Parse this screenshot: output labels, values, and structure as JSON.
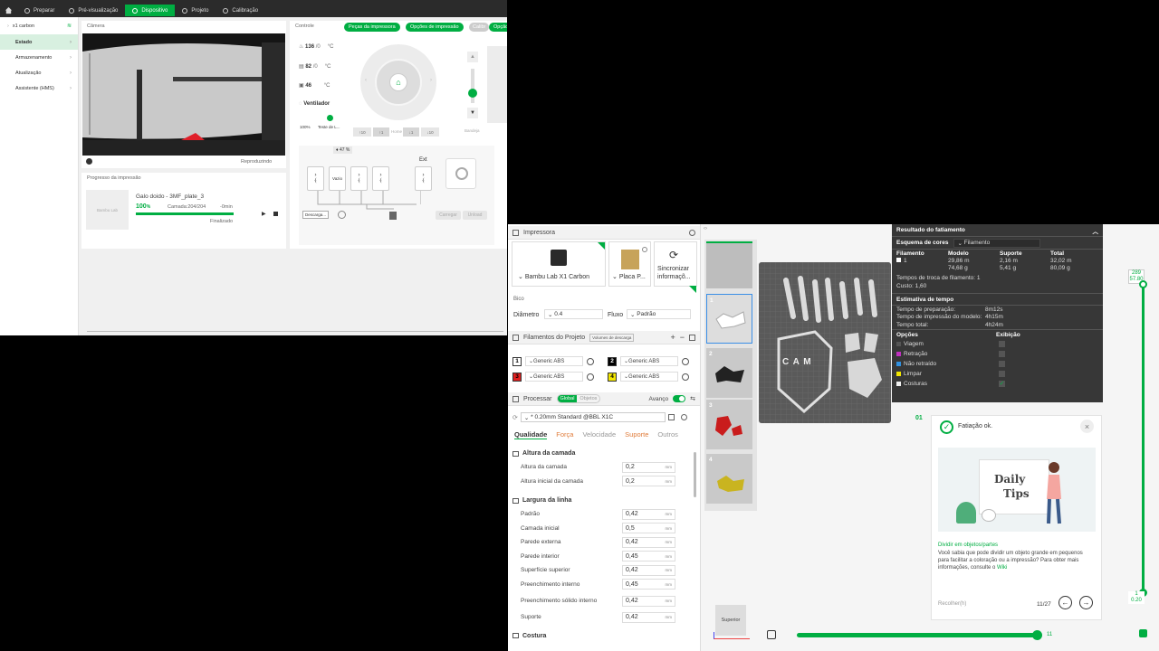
{
  "device": {
    "topnav": {
      "home_icon": "home-icon",
      "tabs": [
        {
          "label": "Preparar"
        },
        {
          "label": "Pré-visualização"
        },
        {
          "label": "Dispositivo",
          "active": true
        },
        {
          "label": "Projeto"
        },
        {
          "label": "Calibração"
        }
      ]
    },
    "sidebar": {
      "printer": "x1 carbon",
      "items": [
        {
          "label": "Estado",
          "active": true
        },
        {
          "label": "Armazenamento"
        },
        {
          "label": "Atualização"
        },
        {
          "label": "Assistente (HMS)"
        }
      ]
    },
    "camera": {
      "title": "Câmera",
      "status": "Reproduzindo"
    },
    "progress": {
      "title": "Progresso da impressão",
      "thumb_label": "Bambu Lab",
      "job": "Galo doido - 3MF_plate_3",
      "percent": "100",
      "percent_sign": "%",
      "layer": "Camada:204/204",
      "time": "-0min",
      "state": "Finalizado",
      "progress_fraction": 1.0
    },
    "controle": {
      "title": "Controle",
      "buttons": [
        "Peças da impressora",
        "Opções de impressão",
        "Calibr",
        "Opção"
      ],
      "temps": [
        {
          "value": "136",
          "target": "/0",
          "unit": "°C"
        },
        {
          "value": "82",
          "target": "/0",
          "unit": "°C"
        },
        {
          "value": "46",
          "target": "",
          "unit": "°C"
        }
      ],
      "fan_label": "Ventilador",
      "fan_percent": "100%",
      "light_label": "Teste de L...",
      "home_label": "⌂",
      "move_left": [
        "10",
        "1"
      ],
      "move_center": "Home",
      "move_right": [
        "1",
        "10"
      ],
      "bed_label": "Bandeja",
      "ams_humidity": "47 %",
      "slot_empty": "Vazio",
      "ext_label": "Ext",
      "unload": "Descarga...",
      "carregar": "Carregar",
      "descarregar": "Unload"
    }
  },
  "slicer": {
    "printer_section": {
      "title": "Impressora",
      "printer_name": "Bambu Lab X1 Carbon",
      "plate": "Placa P...",
      "sync": "Sincronizar informaçõ...",
      "bico_label": "Bico",
      "diameter_label": "Diâmetro",
      "diameter_value": "0.4",
      "flow_label": "Fluxo",
      "flow_value": "Padrão"
    },
    "filaments": {
      "title": "Filamentos do Projeto",
      "volumes_btn": "Volumes de descarga",
      "items": [
        {
          "num": "1",
          "name": "Generic ABS",
          "color": "#ffffff",
          "text": "#000000"
        },
        {
          "num": "2",
          "name": "Generic ABS",
          "color": "#000000",
          "text": "#ffffff"
        },
        {
          "num": "3",
          "name": "Generic ABS",
          "color": "#e02020",
          "text": "#000000"
        },
        {
          "num": "4",
          "name": "Generic ABS",
          "color": "#f2e600",
          "text": "#000000"
        }
      ]
    },
    "process": {
      "title": "Processar",
      "toggle_global": "Global",
      "toggle_objects": "Objetos",
      "advanced": "Avanço",
      "preset": "* 0.20mm Standard @BBL X1C",
      "tabs": [
        {
          "label": "Qualidade",
          "state": "active"
        },
        {
          "label": "Força",
          "state": "warn"
        },
        {
          "label": "Velocidade",
          "state": "normal"
        },
        {
          "label": "Suporte",
          "state": "warn"
        },
        {
          "label": "Outros",
          "state": "normal"
        }
      ],
      "group1": "Altura da camada",
      "group1_rows": [
        {
          "label": "Altura da camada",
          "value": "0,2",
          "unit": "mm"
        },
        {
          "label": "Altura inicial da camada",
          "value": "0,2",
          "unit": "mm"
        }
      ],
      "group2": "Largura da linha",
      "group2_rows": [
        {
          "label": "Padrão",
          "value": "0,42",
          "unit": "mm"
        },
        {
          "label": "Camada inicial",
          "value": "0,5",
          "unit": "mm"
        },
        {
          "label": "Parede externa",
          "value": "0,42",
          "unit": "mm"
        },
        {
          "label": "Parede interior",
          "value": "0,45",
          "unit": "mm"
        },
        {
          "label": "Superfície superior",
          "value": "0,42",
          "unit": "mm"
        },
        {
          "label": "Preenchimento interno",
          "value": "0,45",
          "unit": "mm"
        },
        {
          "label": "Preenchimento sólido interno",
          "value": "0,42",
          "unit": "mm"
        },
        {
          "label": "Suporte",
          "value": "0,42",
          "unit": "mm"
        }
      ],
      "group3": "Costura"
    },
    "plates": [
      {
        "num": "1"
      },
      {
        "num": "2"
      },
      {
        "num": "3"
      },
      {
        "num": "4"
      }
    ],
    "bed_text": "C A M",
    "plate_index": "01",
    "view_label": "Superior",
    "results": {
      "title": "Resultado do fatiamento",
      "color_scheme_label": "Esquema de cores",
      "color_scheme_value": "Filamento",
      "headers": [
        "Filamento",
        "Modelo",
        "Suporte",
        "Total"
      ],
      "row": {
        "num": "1",
        "model_m": "29,86 m",
        "model_g": "74,68 g",
        "sup_m": "2,16 m",
        "sup_g": "5,41 g",
        "tot_m": "32,02 m",
        "tot_g": "80,09 g"
      },
      "changes_label": "Tempos de troca de filamento:",
      "changes_value": "1",
      "cost_label": "Custo:",
      "cost_value": "1,60",
      "time_title": "Estimativa de tempo",
      "prep_label": "Tempo de preparação:",
      "prep_value": "8m12s",
      "model_time_label": "Tempo de impressão do modelo:",
      "model_time_value": "4h15m",
      "total_label": "Tempo total:",
      "total_value": "4h24m",
      "options_label": "Opções",
      "display_label": "Exibição",
      "options": [
        {
          "label": "Viagem",
          "color": "#555555",
          "checked": false
        },
        {
          "label": "Retração",
          "color": "#c030c0",
          "checked": false
        },
        {
          "label": "Não retraído",
          "color": "#3090e0",
          "checked": false
        },
        {
          "label": "Limpar",
          "color": "#f2e600",
          "checked": false
        },
        {
          "label": "Costuras",
          "color": "#f0f0f0",
          "checked": true
        }
      ]
    },
    "layer_slider": {
      "top_a": "289",
      "top_b": "57.80",
      "bottom_a": "1",
      "bottom_b": "0.20"
    },
    "bottom_slider_value": "11",
    "tips": {
      "status": "Fatiação ok.",
      "image_title_1": "Daily",
      "image_title_2": "Tips",
      "link": "Dividir em objetos/partes",
      "body": "Você sabia que pode dividir um objeto grande em pequenos para facilitar a coloração ou a impressão? Para obter mais informações, consulte o",
      "wiki": "Wiki",
      "collapse": "Recolher(h)",
      "page": "11/27"
    }
  }
}
